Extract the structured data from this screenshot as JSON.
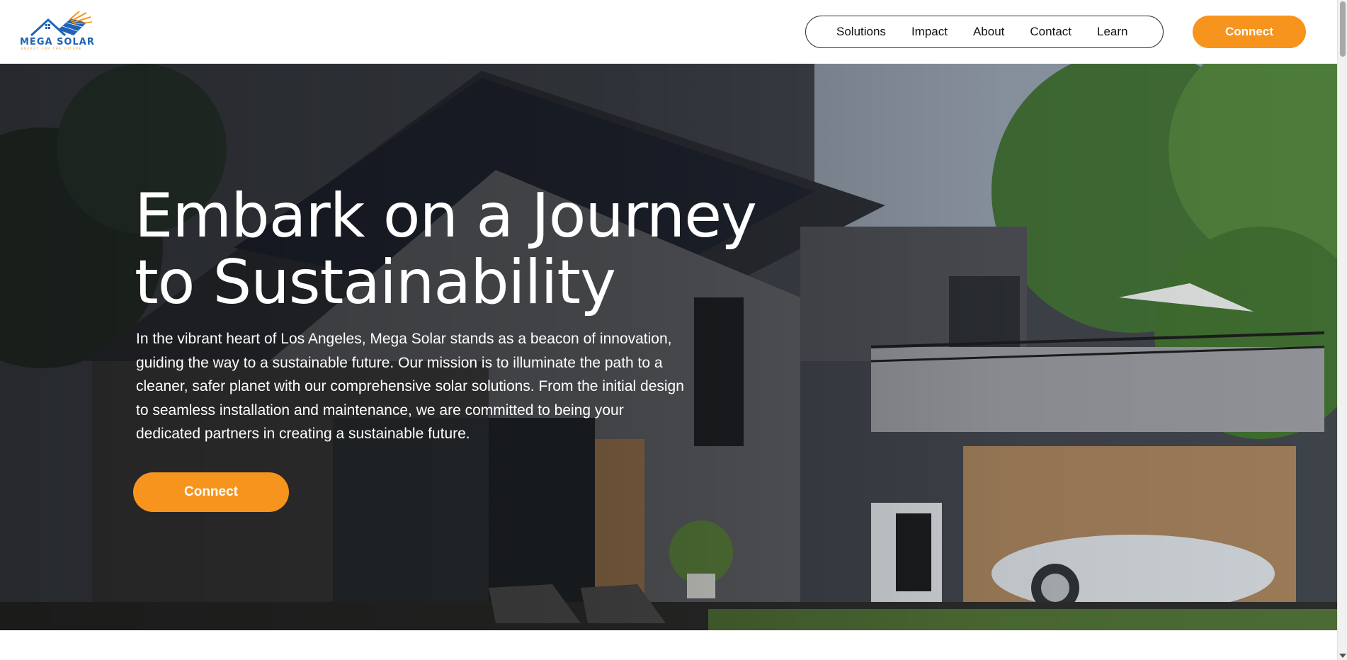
{
  "brand": {
    "name": "MEGA SOLAR",
    "tagline": "ENERGY FOR THE FUTURE",
    "colors": {
      "accent": "#f7941d",
      "logo_blue": "#1e63b5",
      "text_dark": "#111111",
      "hero_text": "#ffffff"
    }
  },
  "nav": {
    "items": [
      "Solutions",
      "Impact",
      "About",
      "Contact",
      "Learn"
    ]
  },
  "header": {
    "cta_label": "Connect"
  },
  "hero": {
    "title": "Embark on a Journey to Sustainability",
    "description": "In the vibrant heart of Los Angeles, Mega Solar stands as a beacon of innovation, guiding the way to a sustainable future. Our mission is to illuminate the path to a cleaner, safer planet with our comprehensive solar solutions. From the initial design to seamless installation and maintenance, we are committed to being your dedicated partners in creating a sustainable future.",
    "cta_label": "Connect",
    "background_image": "modern-house-with-solar-panels-icon"
  },
  "icons": {
    "logo": "solar-house-logo-icon",
    "scroll_down": "chevron-down-icon"
  }
}
